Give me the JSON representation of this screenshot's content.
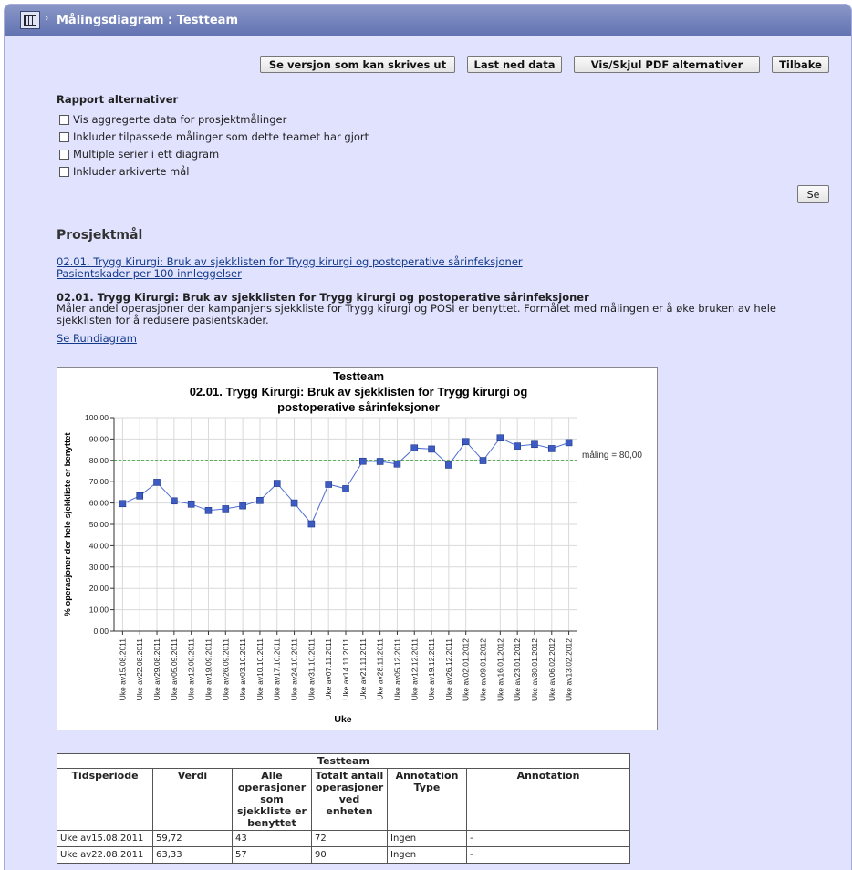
{
  "header": {
    "title": "Målingsdiagram : Testteam",
    "arrow": "›"
  },
  "toolbar": {
    "print_label": "Se versjon som kan skrives ut",
    "download_label": "Last ned data",
    "pdf_label": "Vis/Skjul PDF alternativer",
    "back_label": "Tilbake"
  },
  "report": {
    "heading": "Rapport alternativer",
    "options": [
      {
        "label": "Vis aggregerte data for prosjektmålinger",
        "checked": false
      },
      {
        "label": "Inkluder tilpassede målinger som dette teamet har gjort",
        "checked": false
      },
      {
        "label": "Multiple serier i ett diagram",
        "checked": false
      },
      {
        "label": "Inkluder arkiverte mål",
        "checked": false
      }
    ],
    "apply_label": "Se"
  },
  "goals": {
    "heading": "Prosjektmål",
    "links": [
      "02.01. Trygg Kirurgi: Bruk av sjekklisten for Trygg kirurgi og postoperative sårinfeksjoner",
      "Pasientskader per 100 innleggelser"
    ],
    "selected_title": "02.01. Trygg Kirurgi: Bruk av sjekklisten for Trygg kirurgi og postoperative sårinfeksjoner",
    "description": "Måler andel operasjoner der kampanjens sjekkliste for Trygg kirurgi og POSI er benyttet. Formålet med målingen er å øke bruken av hele sjekklisten for å redusere pasientskader.",
    "pie_link": "Se Rundiagram"
  },
  "chart_data": {
    "type": "line",
    "title": "Testteam",
    "subtitle": "02.01. Trygg Kirurgi: Bruk av sjekklisten for Trygg kirurgi og postoperative sårinfeksjoner",
    "xlabel": "Uke",
    "ylabel": "% operasjoner der hele sjekkliste er benyttet",
    "ylim": [
      0,
      100
    ],
    "yticks": [
      "0,00",
      "10,00",
      "20,00",
      "30,00",
      "40,00",
      "50,00",
      "60,00",
      "70,00",
      "80,00",
      "90,00",
      "100,00"
    ],
    "target": {
      "value": 80,
      "label": "måling = 80,00",
      "color": "#2e9a2e"
    },
    "series_color": "#4f6fd0",
    "marker_color": "#3d5bc2",
    "grid": true,
    "categories": [
      "Uke av15.08.2011",
      "Uke av22.08.2011",
      "Uke av29.08.2011",
      "Uke av05.09.2011",
      "Uke av12.09.2011",
      "Uke av19.09.2011",
      "Uke av26.09.2011",
      "Uke av03.10.2011",
      "Uke av10.10.2011",
      "Uke av17.10.2011",
      "Uke av24.10.2011",
      "Uke av31.10.2011",
      "Uke av07.11.2011",
      "Uke av14.11.2011",
      "Uke av21.11.2011",
      "Uke av28.11.2011",
      "Uke av05.12.2011",
      "Uke av12.12.2011",
      "Uke av19.12.2011",
      "Uke av26.12.2011",
      "Uke av02.01.2012",
      "Uke av09.01.2012",
      "Uke av16.01.2012",
      "Uke av23.01.2012",
      "Uke av30.01.2012",
      "Uke av06.02.2012",
      "Uke av13.02.2012"
    ],
    "values": [
      59.72,
      63.33,
      69.7,
      61,
      59.5,
      56.5,
      57.3,
      58.7,
      61.2,
      69.2,
      60,
      50.2,
      68.8,
      66.7,
      79.6,
      79.5,
      78.3,
      85.8,
      85.3,
      77.8,
      88.8,
      79.9,
      90.5,
      86.7,
      87.5,
      85.5,
      88.3
    ]
  },
  "table": {
    "caption": "Testteam",
    "headers": [
      "Tidsperiode",
      "Verdi",
      "Alle operasjoner som sjekkliste er benyttet",
      "Totalt antall operasjoner ved enheten",
      "Annotation Type",
      "Annotation"
    ],
    "rows": [
      [
        "Uke av15.08.2011",
        "59,72",
        "43",
        "72",
        "Ingen",
        "-"
      ],
      [
        "Uke av22.08.2011",
        "63,33",
        "57",
        "90",
        "Ingen",
        "-"
      ]
    ]
  }
}
